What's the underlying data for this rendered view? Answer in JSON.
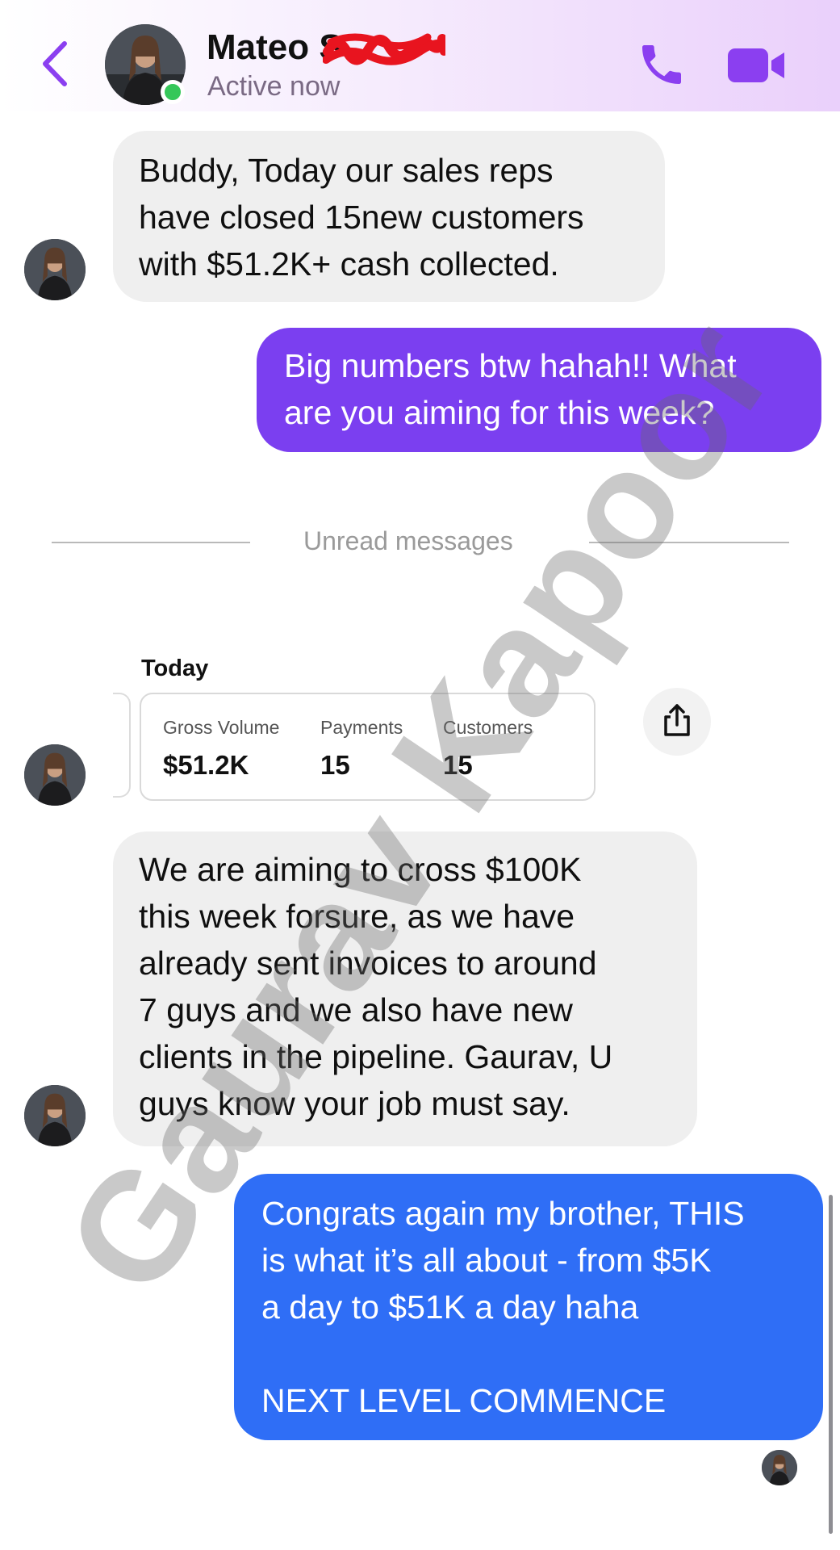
{
  "header": {
    "contact_name": "Mateo S",
    "status": "Active now",
    "colors": {
      "accent": "#8b3ff0",
      "online": "#35c759"
    },
    "icons": [
      "chevron-left-icon",
      "phone-icon",
      "video-camera-icon"
    ]
  },
  "messages": [
    {
      "sender": "contact",
      "text": "Buddy, Today our sales reps\nhave closed 15new customers\nwith $51.2K+ cash collected."
    },
    {
      "sender": "me",
      "text": "Big numbers btw hahah!! What\nare you aiming for this week?"
    },
    {
      "sender": "contact",
      "text": "We are aiming to cross $100K\nthis week forsure, as we have\nalready sent invoices to around\n7 guys and we also have new\nclients in the pipeline. Gaurav, U\nguys know your job must say."
    },
    {
      "sender": "me",
      "text": "Congrats again my brother, THIS\nis what it’s all about - from $5K\na day to $51K a day haha\n\nNEXT LEVEL COMMENCE"
    }
  ],
  "divider": {
    "label": "Unread messages"
  },
  "stats_card": {
    "title": "Today",
    "items": [
      {
        "label": "Gross Volume",
        "value": "$51.2K"
      },
      {
        "label": "Payments",
        "value": "15"
      },
      {
        "label": "Customers",
        "value": "15"
      }
    ],
    "share_icon": "share-icon"
  },
  "watermark": "Gaurav Kapoor",
  "bubble_colors": {
    "incoming": "#efefef",
    "outgoing_purple": "#7b3ff0",
    "outgoing_blue": "#2f6ef6"
  }
}
